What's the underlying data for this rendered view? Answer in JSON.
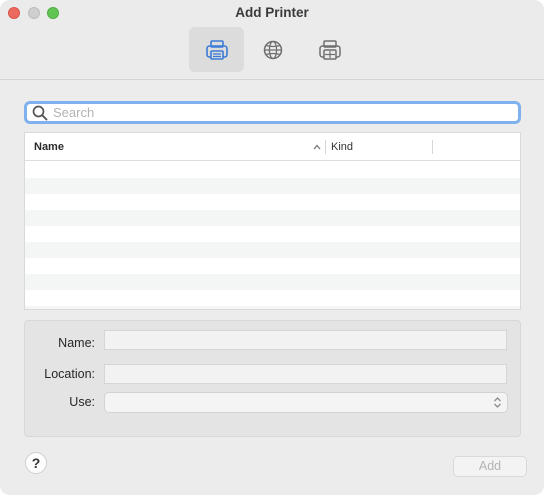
{
  "window": {
    "title": "Add Printer"
  },
  "toolbar": {
    "items": [
      {
        "icon": "default-printer-icon",
        "selected": true
      },
      {
        "icon": "ip-globe-icon",
        "selected": false
      },
      {
        "icon": "windows-printer-icon",
        "selected": false
      }
    ]
  },
  "search": {
    "placeholder": "Search",
    "value": ""
  },
  "table": {
    "columns": [
      {
        "label": "Name",
        "sorted": "ascending"
      },
      {
        "label": "Kind"
      }
    ],
    "rows": []
  },
  "form": {
    "name_label": "Name:",
    "name_value": "",
    "location_label": "Location:",
    "location_value": "",
    "use_label": "Use:",
    "use_value": ""
  },
  "buttons": {
    "help_label": "?",
    "add_label": "Add"
  },
  "colors": {
    "accent": "#3b7bd6",
    "focus_ring": "#7fb1ee",
    "close": "#ed6a5e",
    "zoom": "#61c554"
  }
}
